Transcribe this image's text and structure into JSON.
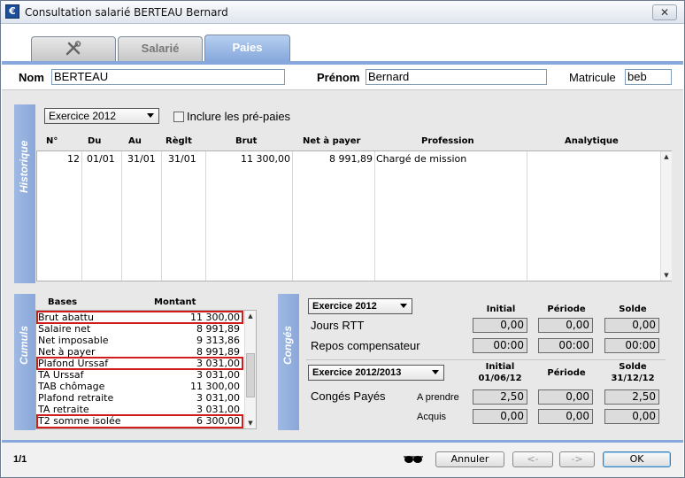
{
  "window": {
    "title": "Consultation salarié BERTEAU Bernard",
    "close_label": "✕",
    "app_icon": "€"
  },
  "tabs": [
    {
      "label": "",
      "icon": "tools-icon"
    },
    {
      "label": "Salarié"
    },
    {
      "label": "Paies"
    }
  ],
  "identity": {
    "nom_label": "Nom",
    "nom_value": "BERTEAU",
    "prenom_label": "Prénom",
    "prenom_value": "Bernard",
    "matricule_label": "Matricule",
    "matricule_value": "beb"
  },
  "historique": {
    "side_label": "Historique",
    "exercice_select": "Exercice 2012",
    "include_prepaies_label": "Inclure les pré-paies",
    "include_prepaies_checked": false,
    "columns": [
      "N°",
      "Du",
      "Au",
      "Règlt",
      "Brut",
      "Net à payer",
      "Profession",
      "Analytique"
    ],
    "rows": [
      {
        "num": "12",
        "du": "01/01",
        "au": "31/01",
        "reglt": "31/01",
        "brut": "11 300,00",
        "net": "8 991,89",
        "profession": "Chargé de mission",
        "analytique": ""
      }
    ]
  },
  "cumuls": {
    "side_label": "Cumuls",
    "col_bases": "Bases",
    "col_montant": "Montant",
    "rows": [
      {
        "base": "Brut abattu",
        "montant": "11 300,00",
        "highlighted": true
      },
      {
        "base": "Salaire net",
        "montant": "8 991,89",
        "highlighted": false
      },
      {
        "base": "Net imposable",
        "montant": "9 313,86",
        "highlighted": false
      },
      {
        "base": "Net à payer",
        "montant": "8 991,89",
        "highlighted": false
      },
      {
        "base": "Plafond Urssaf",
        "montant": "3 031,00",
        "highlighted": true
      },
      {
        "base": "TA Urssaf",
        "montant": "3 031,00",
        "highlighted": false
      },
      {
        "base": "TAB chômage",
        "montant": "11 300,00",
        "highlighted": false
      },
      {
        "base": "Plafond retraite",
        "montant": "3 031,00",
        "highlighted": false
      },
      {
        "base": "TA retraite",
        "montant": "3 031,00",
        "highlighted": false
      },
      {
        "base": "T2 somme isolée",
        "montant": "6 300,00",
        "highlighted": true
      }
    ]
  },
  "conges": {
    "side_label": "Congés",
    "exercice1_select": "Exercice 2012",
    "col_initial": "Initial",
    "col_periode": "Période",
    "col_solde": "Solde",
    "jours_rtt_label": "Jours RTT",
    "jours_rtt": {
      "initial": "0,00",
      "periode": "0,00",
      "solde": "0,00"
    },
    "repos_label": "Repos compensateur",
    "repos": {
      "initial": "00:00",
      "periode": "00:00",
      "solde": "00:00"
    },
    "exercice2_select": "Exercice 2012/2013",
    "col2_initial": "Initial",
    "col2_initial_date": "01/06/12",
    "col2_periode": "Période",
    "col2_solde": "Solde",
    "col2_solde_date": "31/12/12",
    "conges_payes_label": "Congés Payés",
    "a_prendre_label": "A prendre",
    "a_prendre": {
      "initial": "2,50",
      "periode": "0,00",
      "solde": "2,50"
    },
    "acquis_label": "Acquis",
    "acquis": {
      "initial": "0,00",
      "periode": "0,00",
      "solde": "0,00"
    }
  },
  "footer": {
    "pagination": "1/1",
    "glasses_icon": "glasses-icon",
    "annuler_label": "Annuler",
    "prev_label": "<-",
    "next_label": "->",
    "ok_label": "OK"
  },
  "colors": {
    "accent": "#86a8dc",
    "highlight": "#d01c1c"
  }
}
